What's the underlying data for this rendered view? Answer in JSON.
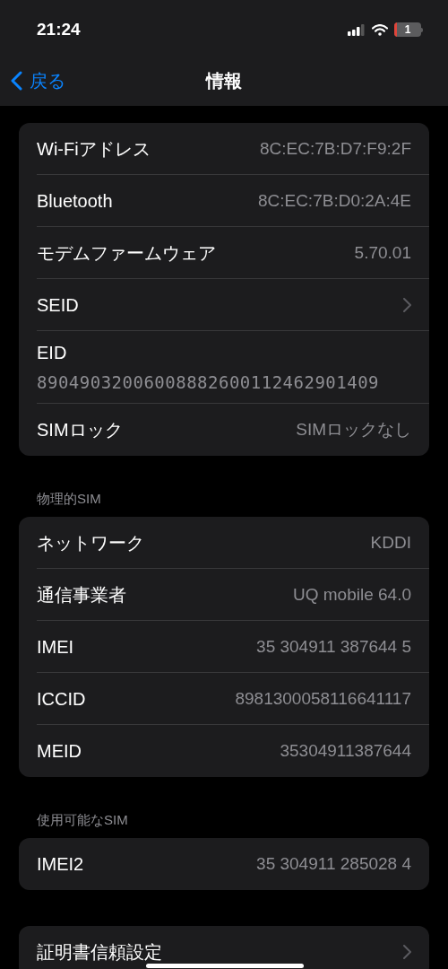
{
  "status_bar": {
    "time": "21:24",
    "battery": "1"
  },
  "nav": {
    "back": "戻る",
    "title": "情報"
  },
  "sections": [
    {
      "rows": [
        {
          "kind": "value",
          "label": "Wi-Fiアドレス",
          "value": "8C:EC:7B:D7:F9:2F"
        },
        {
          "kind": "value",
          "label": "Bluetooth",
          "value": "8C:EC:7B:D0:2A:4E"
        },
        {
          "kind": "value",
          "label": "モデムファームウェア",
          "value": "5.70.01"
        },
        {
          "kind": "link",
          "label": "SEID"
        },
        {
          "kind": "stacked",
          "label": "EID",
          "value": "89049032006008882600112462901409"
        },
        {
          "kind": "value",
          "label": "SIMロック",
          "value": "SIMロックなし"
        }
      ]
    },
    {
      "header": "物理的SIM",
      "rows": [
        {
          "kind": "value",
          "label": "ネットワーク",
          "value": "KDDI"
        },
        {
          "kind": "value",
          "label": "通信事業者",
          "value": "UQ mobile 64.0"
        },
        {
          "kind": "value",
          "label": "IMEI",
          "value": "35 304911 387644 5"
        },
        {
          "kind": "value",
          "label": "ICCID",
          "value": "8981300058116641117"
        },
        {
          "kind": "value",
          "label": "MEID",
          "value": "35304911387644"
        }
      ]
    },
    {
      "header": "使用可能なSIM",
      "rows": [
        {
          "kind": "value",
          "label": "IMEI2",
          "value": "35 304911 285028 4"
        }
      ]
    },
    {
      "rows": [
        {
          "kind": "link",
          "label": "証明書信頼設定"
        }
      ]
    }
  ]
}
